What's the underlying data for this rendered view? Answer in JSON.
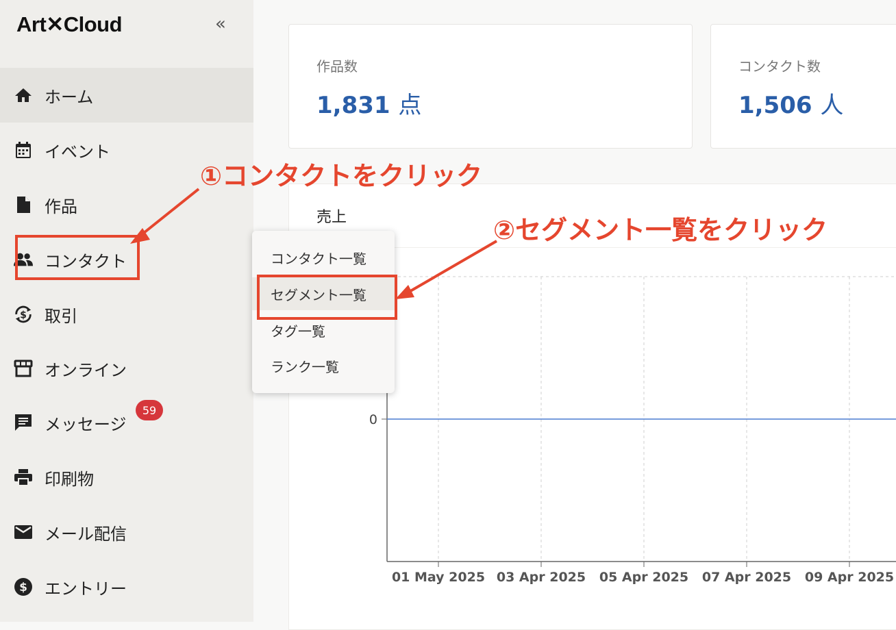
{
  "brand": {
    "logo": "Art✕Cloud",
    "collapse_icon": "«"
  },
  "sidebar": {
    "items": [
      {
        "label": "ホーム",
        "icon": "home-icon"
      },
      {
        "label": "イベント",
        "icon": "calendar-icon"
      },
      {
        "label": "作品",
        "icon": "document-icon"
      },
      {
        "label": "コンタクト",
        "icon": "people-icon"
      },
      {
        "label": "取引",
        "icon": "dollar-cycle-icon"
      },
      {
        "label": "オンライン",
        "icon": "store-icon"
      },
      {
        "label": "メッセージ",
        "icon": "message-icon",
        "badge": "59"
      },
      {
        "label": "印刷物",
        "icon": "printer-icon"
      },
      {
        "label": "メール配信",
        "icon": "mail-icon"
      },
      {
        "label": "エントリー",
        "icon": "dollar-circle-icon"
      }
    ],
    "active_index": 0
  },
  "stats": [
    {
      "label": "作品数",
      "value": "1,831",
      "unit": "点"
    },
    {
      "label": "コンタクト数",
      "value": "1,506",
      "unit": "人"
    }
  ],
  "sales_panel": {
    "title": "売上"
  },
  "dropdown": {
    "items": [
      "コンタクト一覧",
      "セグメント一覧",
      "タグ一覧",
      "ランク一覧"
    ],
    "highlighted_index": 1
  },
  "annotations": {
    "step1": "①コンタクトをクリック",
    "step2": "②セグメント一覧をクリック",
    "color": "#e5462e"
  },
  "chart_data": {
    "type": "line",
    "categories": [
      "01 May 2025",
      "03 Apr 2025",
      "05 Apr 2025",
      "07 Apr 2025",
      "09 Apr 2025"
    ],
    "series": [
      {
        "values": [
          0,
          0,
          0,
          0,
          0
        ],
        "color": "#4a7bd0"
      }
    ],
    "y_tick_labels": [
      "0"
    ],
    "grid": true
  }
}
